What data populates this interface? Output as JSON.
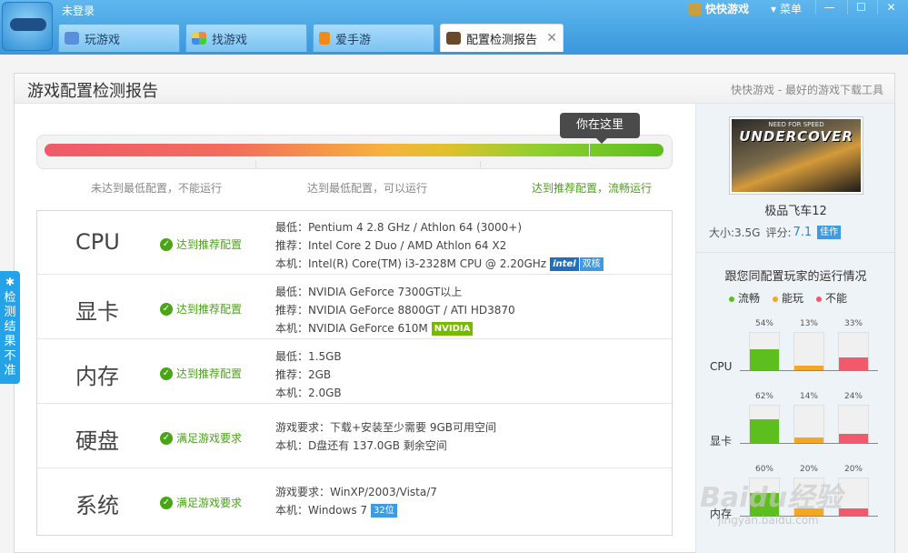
{
  "titlebar": {
    "login_text": "未登录",
    "user_label": "快快游戏",
    "menu_label": "菜单",
    "tabs": [
      {
        "label": "玩游戏",
        "icon": "gamepad-icon"
      },
      {
        "label": "找游戏",
        "icon": "grid-icon"
      },
      {
        "label": "爱手游",
        "icon": "phone-icon"
      },
      {
        "label": "配置检测报告",
        "icon": "game-cover-icon",
        "active": true
      }
    ]
  },
  "panel": {
    "title": "游戏配置检测报告",
    "slogan": "快快游戏 - 最好的游戏下载工具"
  },
  "meter": {
    "tip": "你在这里",
    "level": 0.88,
    "labels": [
      "未达到最低配置，不能运行",
      "达到最低配置，可以运行",
      "达到推荐配置，流畅运行"
    ]
  },
  "specs": [
    {
      "name": "CPU",
      "status": "达到推荐配置",
      "lines": [
        "最低：Pentium 4 2.8 GHz / Athlon 64 (3000+)",
        "推荐：Intel Core 2 Duo / AMD Athlon 64 X2",
        "本机：Intel(R) Core(TM) i3-2328M CPU @ 2.20GHz"
      ],
      "badges": [
        "intel",
        "双核"
      ]
    },
    {
      "name": "显卡",
      "status": "达到推荐配置",
      "lines": [
        "最低：NVIDIA GeForce 7300GT以上",
        "推荐：NVIDIA GeForce 8800GT / ATI HD3870",
        "本机：NVIDIA GeForce 610M"
      ],
      "badges": [
        "NVIDIA"
      ]
    },
    {
      "name": "内存",
      "status": "达到推荐配置",
      "lines": [
        "最低：1.5GB",
        "推荐：2GB",
        "本机：2.0GB"
      ]
    },
    {
      "name": "硬盘",
      "status": "满足游戏要求",
      "lines": [
        "游戏要求：下载+安装至少需要 9GB可用空间",
        "本机：D盘还有 137.0GB 剩余空间"
      ]
    },
    {
      "name": "系统",
      "status": "满足游戏要求",
      "lines": [
        "游戏要求：WinXP/2003/Vista/7",
        "本机：Windows 7"
      ],
      "badges": [
        "32位"
      ]
    }
  ],
  "sidebar": {
    "cover_sub": "NEED FOR SPEED",
    "cover_title": "UNDERCOVER",
    "game_name": "极品飞车12",
    "size_label": "大小:3.5G",
    "rating_label": "评分:",
    "rating_value": "7.1",
    "rating_badge": "佳作",
    "same_title": "跟您同配置玩家的运行情况",
    "legend": [
      {
        "label": "流畅",
        "color": "#5cbf1e"
      },
      {
        "label": "能玩",
        "color": "#f5a623"
      },
      {
        "label": "不能",
        "color": "#f05a6a"
      }
    ],
    "groups": [
      {
        "label": "CPU",
        "values": [
          54,
          13,
          33
        ]
      },
      {
        "label": "显卡",
        "values": [
          62,
          14,
          24
        ]
      },
      {
        "label": "内存",
        "values": [
          60,
          20,
          20
        ]
      }
    ]
  },
  "side_tab": {
    "label": "检测结果不准"
  },
  "watermark": {
    "logo": "Baidu经验",
    "url": "jingyan.baidu.com"
  }
}
